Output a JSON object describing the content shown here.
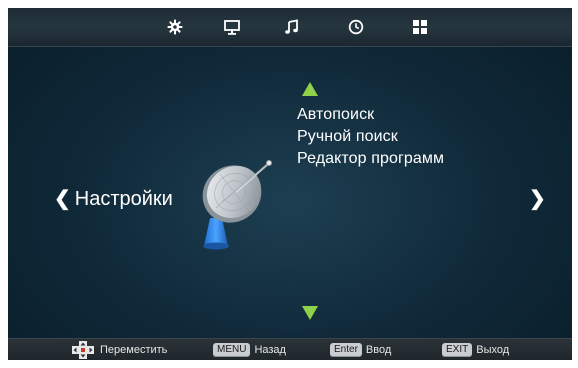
{
  "topbar": {
    "tabs": [
      {
        "name": "settings",
        "icon": "gear-icon",
        "active": true
      },
      {
        "name": "picture",
        "icon": "monitor-icon"
      },
      {
        "name": "sound",
        "icon": "music-note-icon"
      },
      {
        "name": "time",
        "icon": "clock-icon"
      },
      {
        "name": "options",
        "icon": "grid-icon"
      }
    ]
  },
  "section": {
    "title": "Настройки",
    "prev_glyph": "❮",
    "next_glyph": "❯"
  },
  "menu": {
    "items": [
      "Автопоиск",
      "Ручной поиск",
      "Редактор программ"
    ]
  },
  "colors": {
    "arrow": "#8fd14a",
    "accent": "#8fd14a"
  },
  "footer": {
    "move_label": "Переместить",
    "menu_key": "MENU",
    "back_label": "Назад",
    "enter_key": "Enter",
    "enter_label": "Ввод",
    "exit_key": "EXIT",
    "exit_label": "Выход"
  }
}
